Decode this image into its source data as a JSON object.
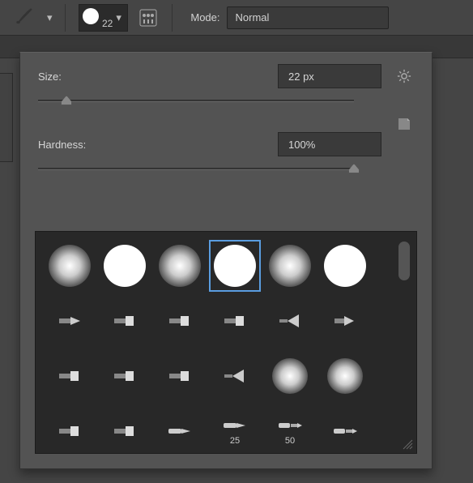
{
  "toolbar": {
    "brush_size": "22",
    "mode_label": "Mode:",
    "mode_value": "Normal"
  },
  "panel": {
    "size_label": "Size:",
    "size_value": "22 px",
    "hardness_label": "Hardness:",
    "hardness_value": "100%",
    "size_pct": 9,
    "hardness_pct": 100
  },
  "presets": [
    {
      "kind": "soft",
      "sel": false
    },
    {
      "kind": "hard",
      "sel": false
    },
    {
      "kind": "soft",
      "sel": false
    },
    {
      "kind": "hard",
      "sel": true
    },
    {
      "kind": "soft",
      "sel": false
    },
    {
      "kind": "hard",
      "sel": false
    },
    {
      "kind": "tip",
      "shape": "needle"
    },
    {
      "kind": "tip",
      "shape": "square"
    },
    {
      "kind": "tip",
      "shape": "square"
    },
    {
      "kind": "tip",
      "shape": "square"
    },
    {
      "kind": "tip",
      "shape": "fan"
    },
    {
      "kind": "tip",
      "shape": "flat-point"
    },
    {
      "kind": "tip",
      "shape": "square"
    },
    {
      "kind": "tip",
      "shape": "square"
    },
    {
      "kind": "tip",
      "shape": "square"
    },
    {
      "kind": "tip",
      "shape": "fan"
    },
    {
      "kind": "softmed"
    },
    {
      "kind": "softmed"
    },
    {
      "kind": "tip",
      "shape": "square"
    },
    {
      "kind": "tip",
      "shape": "square"
    },
    {
      "kind": "tip",
      "shape": "pen"
    },
    {
      "kind": "tip",
      "shape": "pen",
      "label": "25"
    },
    {
      "kind": "tip",
      "shape": "dualpen",
      "label": "50"
    },
    {
      "kind": "tip",
      "shape": "dualpen"
    }
  ]
}
